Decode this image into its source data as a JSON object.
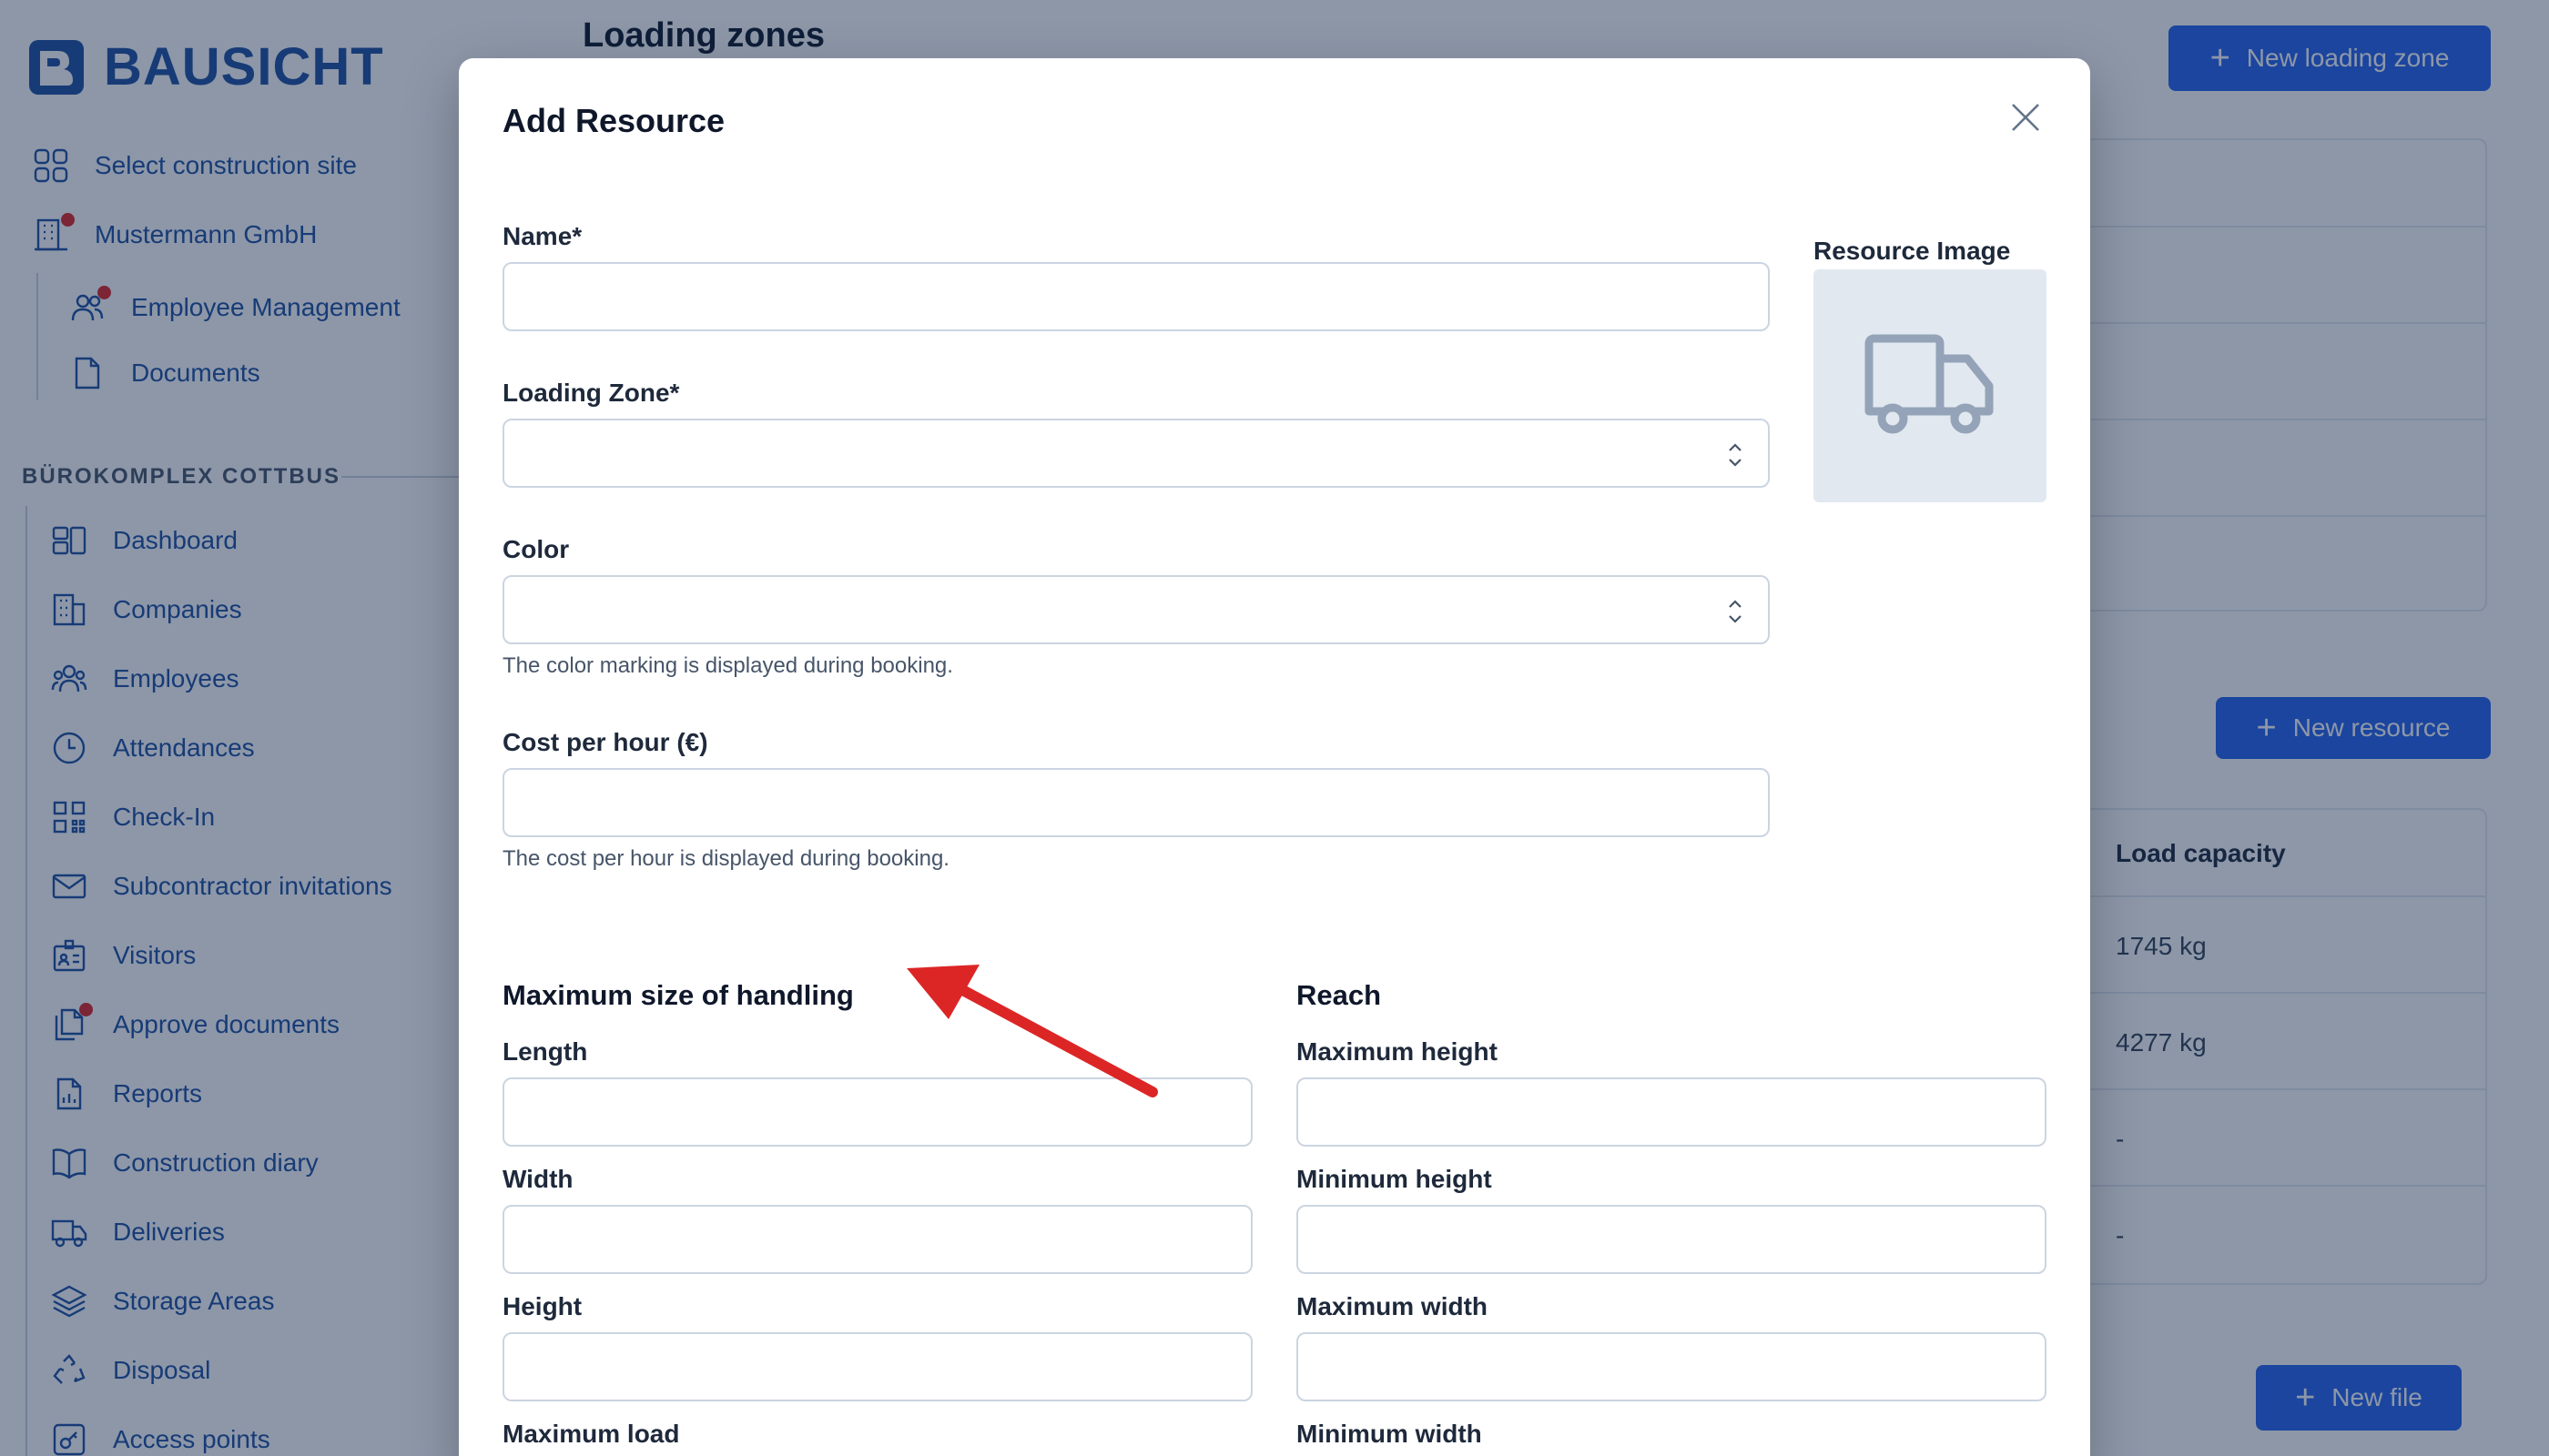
{
  "app": {
    "brand": "BAUSICHT",
    "page_title": "Loading zones",
    "new_loading_zone_label": "New loading zone",
    "new_resource_label": "New resource",
    "new_file_label": "New file"
  },
  "sidebar": {
    "top_items": [
      {
        "label": "Select construction site",
        "icon": "grid-icon"
      },
      {
        "label": "Mustermann GmbH",
        "icon": "building-icon",
        "badge": true
      }
    ],
    "sub_items": [
      {
        "label": "Employee Management",
        "icon": "users-icon",
        "badge": true
      },
      {
        "label": "Documents",
        "icon": "document-icon"
      }
    ],
    "section_title": "BÜROKOMPLEX COTTBUS",
    "items": [
      {
        "label": "Dashboard",
        "icon": "dashboard-icon"
      },
      {
        "label": "Companies",
        "icon": "companies-icon"
      },
      {
        "label": "Employees",
        "icon": "employees-icon"
      },
      {
        "label": "Attendances",
        "icon": "clock-icon"
      },
      {
        "label": "Check-In",
        "icon": "qr-icon"
      },
      {
        "label": "Subcontractor invitations",
        "icon": "mail-icon"
      },
      {
        "label": "Visitors",
        "icon": "id-badge-icon"
      },
      {
        "label": "Approve documents",
        "icon": "documents-icon",
        "badge": true
      },
      {
        "label": "Reports",
        "icon": "report-icon"
      },
      {
        "label": "Construction diary",
        "icon": "book-icon"
      },
      {
        "label": "Deliveries",
        "icon": "truck-icon"
      },
      {
        "label": "Storage Areas",
        "icon": "layers-icon"
      },
      {
        "label": "Disposal",
        "icon": "recycle-icon"
      },
      {
        "label": "Access points",
        "icon": "key-icon"
      }
    ]
  },
  "resources_table": {
    "load_capacity_header": "Load capacity",
    "load_capacity_values": [
      "1745 kg",
      "4277 kg",
      "-",
      "-"
    ]
  },
  "modal": {
    "title": "Add Resource",
    "name_label": "Name*",
    "name_value": "",
    "loading_zone_label": "Loading Zone*",
    "loading_zone_value": "",
    "color_label": "Color",
    "color_value": "",
    "color_help": "The color marking is displayed during booking.",
    "cost_label": "Cost per hour (€)",
    "cost_value": "",
    "cost_help": "The cost per hour is displayed during booking.",
    "resource_image_label": "Resource Image",
    "handling_title": "Maximum size of handling",
    "length_label": "Length",
    "width_label": "Width",
    "height_label": "Height",
    "max_load_label": "Maximum load",
    "reach_title": "Reach",
    "max_height_label": "Maximum height",
    "min_height_label": "Minimum height",
    "max_width_label": "Maximum width",
    "min_width_label": "Minimum width"
  },
  "colors": {
    "brand_blue": "#1e4fa0",
    "primary": "#2563eb",
    "annotation_arrow": "#dc2626",
    "badge": "#dc2626"
  }
}
